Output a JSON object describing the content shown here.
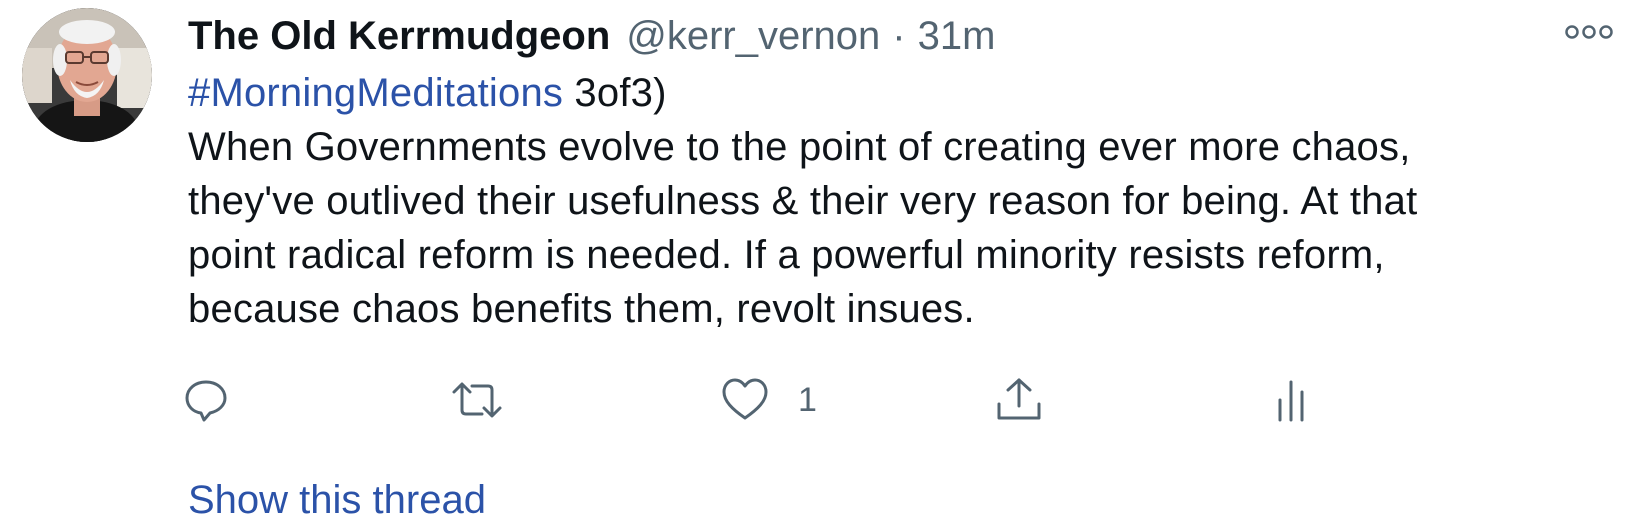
{
  "tweet": {
    "author": {
      "display_name": "The Old Kerrmudgeon",
      "handle": "@kerr_vernon"
    },
    "separator": "·",
    "timestamp": "31m",
    "hashtag": "#MorningMeditations",
    "hashtag_suffix": " 3of3)",
    "body_lines": [
      "When Governments evolve to the point of creating ever more chaos,",
      "they've outlived their usefulness & their very reason for being. At that",
      "point radical reform is needed. If a powerful minority resists reform,",
      "because chaos benefits them, revolt insues."
    ],
    "actions": {
      "reply_icon": "reply-icon",
      "retweet_icon": "retweet-icon",
      "like_icon": "heart-icon",
      "like_count": "1",
      "share_icon": "share-icon",
      "analytics_icon": "analytics-icon"
    },
    "show_thread": "Show this thread"
  },
  "colors": {
    "link": "#2b52a8",
    "text": "#0f1419",
    "secondary": "#536471"
  }
}
